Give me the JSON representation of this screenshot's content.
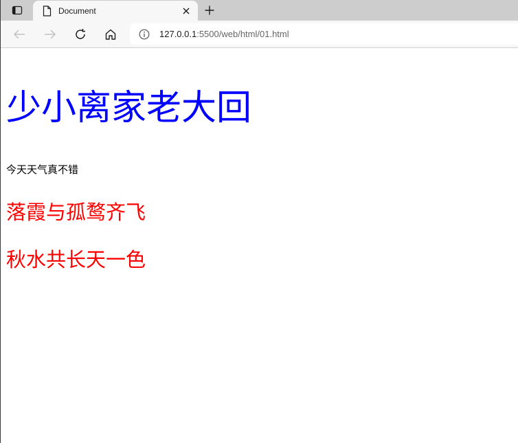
{
  "browser": {
    "tab": {
      "title": "Document",
      "close_label": "×"
    },
    "new_tab_label": "+",
    "address": {
      "host": "127.0.0.1",
      "rest": ":5500/web/html/01.html"
    }
  },
  "page": {
    "heading": "少小离家老大回",
    "paragraph": "今天天气真不错",
    "line1": "落霞与孤鹜齐飞",
    "line2": "秋水共长天一色",
    "colors": {
      "heading": "#0000ff",
      "red_lines": "#ff0000",
      "paragraph": "#000000"
    }
  }
}
